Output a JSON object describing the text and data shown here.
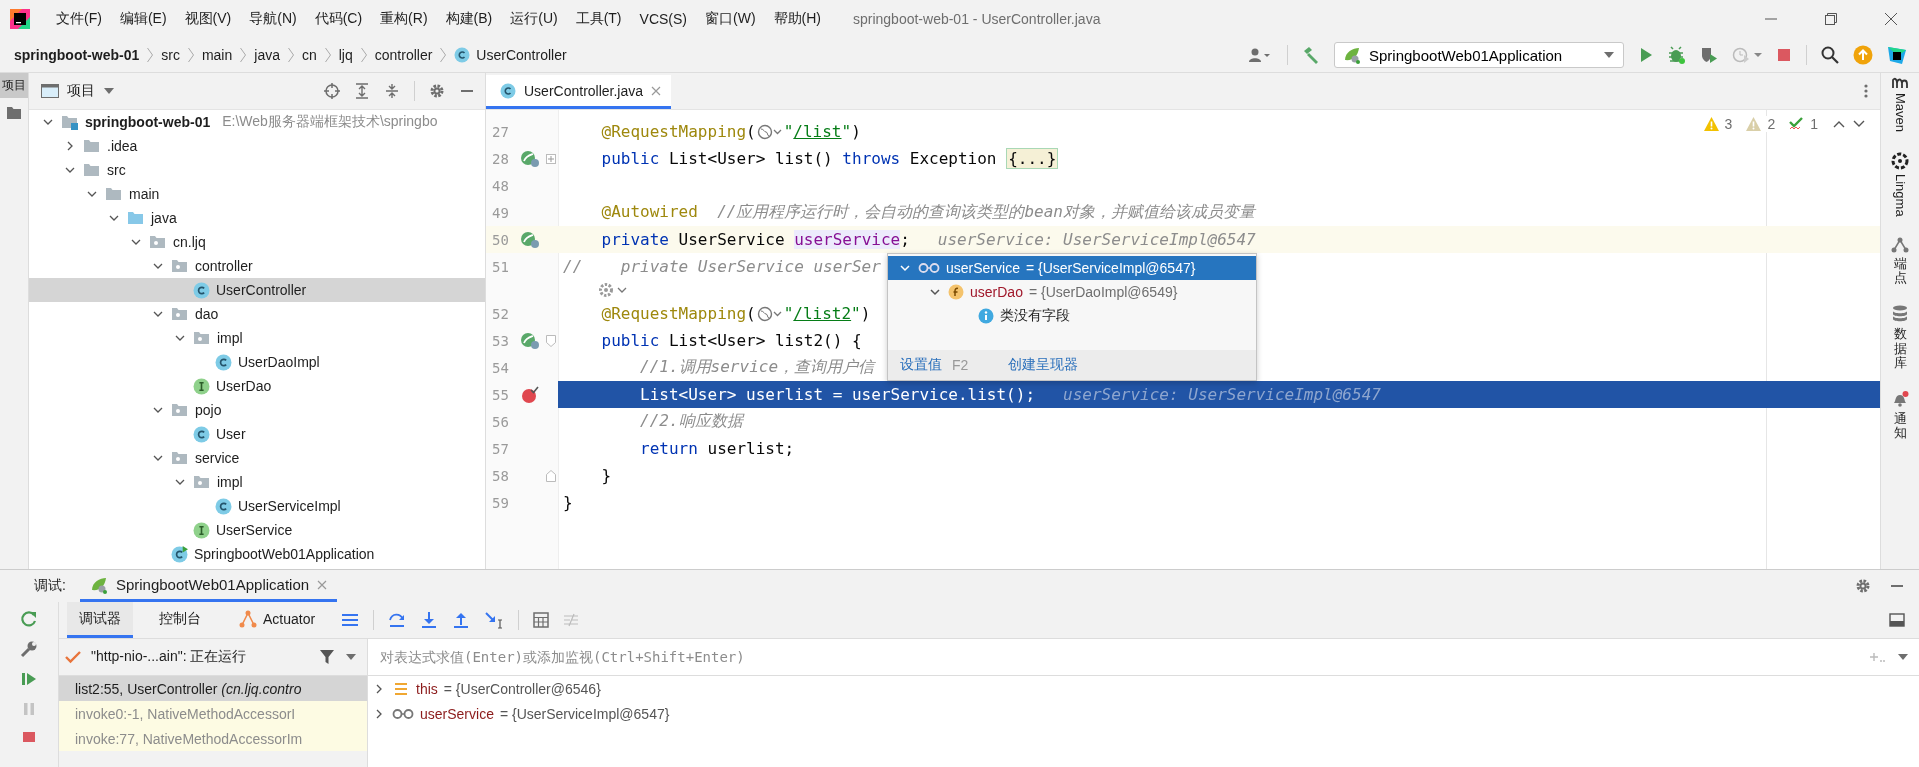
{
  "title_bar": {
    "menu": [
      "文件(F)",
      "编辑(E)",
      "视图(V)",
      "导航(N)",
      "代码(C)",
      "重构(R)",
      "构建(B)",
      "运行(U)",
      "工具(T)",
      "VCS(S)",
      "窗口(W)",
      "帮助(H)"
    ],
    "title": "springboot-web-01 - UserController.java"
  },
  "breadcrumbs": [
    {
      "label": "springboot-web-01",
      "kind": "project"
    },
    {
      "label": "src",
      "kind": "dir"
    },
    {
      "label": "main",
      "kind": "dir"
    },
    {
      "label": "java",
      "kind": "dir"
    },
    {
      "label": "cn",
      "kind": "dir"
    },
    {
      "label": "ljq",
      "kind": "dir"
    },
    {
      "label": "controller",
      "kind": "dir"
    },
    {
      "label": "UserController",
      "kind": "class"
    }
  ],
  "toolbar": {
    "run_config": "SpringbootWeb01Application"
  },
  "left_stripe": [
    {
      "label": "项目",
      "selected": true
    }
  ],
  "project_panel": {
    "title": "项目",
    "tree": [
      {
        "name": "springboot-web-01",
        "kind": "module",
        "detail": "E:\\Web服务器端框架技术\\springbo",
        "expanded": true,
        "selected": false,
        "children": [
          {
            "name": ".idea",
            "kind": "folder",
            "expanded": false,
            "selected": false
          },
          {
            "name": "src",
            "kind": "folder",
            "expanded": true,
            "selected": false,
            "children": [
              {
                "name": "main",
                "kind": "folder",
                "expanded": true,
                "selected": false,
                "children": [
                  {
                    "name": "java",
                    "kind": "source",
                    "expanded": true,
                    "selected": false,
                    "children": [
                      {
                        "name": "cn.ljq",
                        "kind": "package",
                        "expanded": true,
                        "selected": false,
                        "children": [
                          {
                            "name": "controller",
                            "kind": "package",
                            "expanded": true,
                            "selected": false,
                            "children": [
                              {
                                "name": "UserController",
                                "kind": "class",
                                "selected": true
                              }
                            ]
                          },
                          {
                            "name": "dao",
                            "kind": "package",
                            "expanded": true,
                            "selected": false,
                            "children": [
                              {
                                "name": "impl",
                                "kind": "package",
                                "expanded": true,
                                "selected": false,
                                "children": [
                                  {
                                    "name": "UserDaoImpl",
                                    "kind": "class",
                                    "selected": false
                                  }
                                ]
                              },
                              {
                                "name": "UserDao",
                                "kind": "interface",
                                "selected": false
                              }
                            ]
                          },
                          {
                            "name": "pojo",
                            "kind": "package",
                            "expanded": true,
                            "selected": false,
                            "children": [
                              {
                                "name": "User",
                                "kind": "class",
                                "selected": false
                              }
                            ]
                          },
                          {
                            "name": "service",
                            "kind": "package",
                            "expanded": true,
                            "selected": false,
                            "children": [
                              {
                                "name": "impl",
                                "kind": "package",
                                "expanded": true,
                                "selected": false,
                                "children": [
                                  {
                                    "name": "UserServiceImpl",
                                    "kind": "class",
                                    "selected": false
                                  }
                                ]
                              },
                              {
                                "name": "UserService",
                                "kind": "interface",
                                "selected": false
                              }
                            ]
                          },
                          {
                            "name": "SpringbootWeb01Application",
                            "kind": "app",
                            "selected": false
                          }
                        ]
                      }
                    ]
                  }
                ]
              }
            ]
          }
        ]
      }
    ]
  },
  "editor": {
    "tabs": [
      {
        "label": "UserController.java",
        "selected": true
      }
    ],
    "inspections": [
      {
        "kind": "warning",
        "count": "3"
      },
      {
        "kind": "weak-warning",
        "count": "2"
      },
      {
        "kind": "typo",
        "count": "1"
      }
    ],
    "lines": [
      {
        "kind": "code",
        "number": "27",
        "current": false,
        "execution_point": false,
        "tokens": [
          {
            "kind": "annotation",
            "t": "    @RequestMapping"
          },
          {
            "kind": "plain",
            "t": "("
          },
          {
            "kind": "globe"
          },
          {
            "kind": "string",
            "t": "\""
          },
          {
            "kind": "url",
            "t": "/list"
          },
          {
            "kind": "string",
            "t": "\""
          },
          {
            "kind": "plain",
            "t": ")"
          }
        ]
      },
      {
        "kind": "code",
        "number": "28",
        "current": false,
        "execution_point": false,
        "gutter": {
          "kind": "bean"
        },
        "fold": {
          "kind": "folded"
        },
        "tokens": [
          {
            "kind": "keyword",
            "t": "    public"
          },
          {
            "kind": "plain",
            "t": " List<User> list() "
          },
          {
            "kind": "keyword",
            "t": "throws"
          },
          {
            "kind": "plain",
            "t": " Exception "
          },
          {
            "kind": "fold",
            "t": "{...}"
          }
        ]
      },
      {
        "kind": "code",
        "number": "48",
        "current": false,
        "execution_point": false
      },
      {
        "kind": "code",
        "number": "49",
        "current": false,
        "execution_point": false,
        "tokens": [
          {
            "kind": "annotation",
            "t": "    @Autowired"
          },
          {
            "kind": "comment",
            "t": "  //应用程序运行时，会自动的查询该类型的bean对象，并赋值给该成员变量"
          }
        ]
      },
      {
        "kind": "code",
        "number": "50",
        "current": true,
        "execution_point": false,
        "gutter": {
          "kind": "bean"
        },
        "tokens": [
          {
            "kind": "keyword",
            "t": "    private"
          },
          {
            "kind": "plain",
            "t": " UserService "
          },
          {
            "kind": "field",
            "t": "userService"
          },
          {
            "kind": "plain",
            "t": ";"
          },
          {
            "kind": "hint",
            "t": "userService: UserServiceImpl@6547"
          }
        ]
      },
      {
        "kind": "code",
        "number": "51",
        "current": false,
        "execution_point": false,
        "tokens": [
          {
            "kind": "comment",
            "t": "//    private UserService userSer"
          }
        ]
      },
      {
        "kind": "inlay"
      },
      {
        "kind": "code",
        "number": "52",
        "current": false,
        "execution_point": false,
        "tokens": [
          {
            "kind": "annotation",
            "t": "    @RequestMapping"
          },
          {
            "kind": "plain",
            "t": "("
          },
          {
            "kind": "globe"
          },
          {
            "kind": "string",
            "t": "\""
          },
          {
            "kind": "url",
            "t": "/list2"
          },
          {
            "kind": "string",
            "t": "\""
          },
          {
            "kind": "plain",
            "t": ")"
          }
        ]
      },
      {
        "kind": "code",
        "number": "53",
        "current": false,
        "execution_point": false,
        "gutter": {
          "kind": "bean"
        },
        "fold": {
          "kind": "start"
        },
        "tokens": [
          {
            "kind": "keyword",
            "t": "    public"
          },
          {
            "kind": "plain",
            "t": " List<User> list2() {"
          }
        ]
      },
      {
        "kind": "code",
        "number": "54",
        "current": false,
        "execution_point": false,
        "tokens": [
          {
            "kind": "comment",
            "t": "        //1.调用service，查询用户信"
          }
        ]
      },
      {
        "kind": "code",
        "number": "55",
        "current": false,
        "execution_point": true,
        "gutter": {
          "kind": "breakpoint"
        },
        "tokens": [
          {
            "kind": "plain",
            "t": "        List<User> userlist = userService.list();"
          },
          {
            "kind": "hint",
            "t": "userService: UserServiceImpl@6547"
          }
        ]
      },
      {
        "kind": "code",
        "number": "56",
        "current": false,
        "execution_point": false,
        "tokens": [
          {
            "kind": "comment",
            "t": "        //2.响应数据"
          }
        ]
      },
      {
        "kind": "code",
        "number": "57",
        "current": false,
        "execution_point": false,
        "tokens": [
          {
            "kind": "keyword",
            "t": "        return"
          },
          {
            "kind": "plain",
            "t": " userlist;"
          }
        ]
      },
      {
        "kind": "code",
        "number": "58",
        "current": false,
        "execution_point": false,
        "fold": {
          "kind": "end"
        },
        "tokens": [
          {
            "kind": "plain",
            "t": "    }"
          }
        ]
      },
      {
        "kind": "code",
        "number": "59",
        "current": false,
        "execution_point": false,
        "tokens": [
          {
            "kind": "plain",
            "t": "}"
          }
        ]
      }
    ],
    "popup": {
      "tree": [
        {
          "kind": "watch",
          "name": "userService",
          "value": "= {UserServiceImpl@6547}",
          "expanded": true,
          "selected": true,
          "children": [
            {
              "kind": "field",
              "name": "userDao",
              "value": "= {UserDaoImpl@6549}",
              "expanded": true,
              "selected": false,
              "children": [
                {
                  "kind": "info",
                  "name": "类没有字段",
                  "selected": false
                }
              ]
            }
          ]
        }
      ],
      "actions": [
        {
          "label": "设置值",
          "shortcut": "F2"
        },
        {
          "label": "创建呈现器"
        }
      ]
    }
  },
  "right_stripe": [
    {
      "label": "Maven",
      "kind": "maven"
    },
    {
      "label": "Lingma",
      "kind": "lingma"
    },
    {
      "label": "端点",
      "kind": "endpoints"
    },
    {
      "label": "数据库",
      "kind": "database"
    },
    {
      "label": "通知",
      "kind": "notifications"
    }
  ],
  "debug": {
    "label": "调试:",
    "session": "SpringbootWeb01Application",
    "tabs": [
      {
        "label": "调试器",
        "kind": "debugger",
        "selected": true
      },
      {
        "label": "控制台",
        "kind": "console",
        "selected": false
      },
      {
        "label": "Actuator",
        "kind": "actuator",
        "selected": false
      }
    ],
    "thread": "\"http-nio-...ain\": 正在运行",
    "frames": [
      {
        "text": "list2:55, UserController *(cn.ljq.contro*",
        "kind": "user",
        "selected": true
      },
      {
        "text": "invoke0:-1, NativeMethodAccessorI",
        "kind": "library",
        "selected": false
      },
      {
        "text": "invoke:77, NativeMethodAccessorIm",
        "kind": "library",
        "selected": false
      }
    ],
    "eval_placeholder": "对表达式求值(Enter)或添加监视(Ctrl+Shift+Enter)",
    "variables": [
      {
        "kind": "this",
        "name": "this",
        "value": "= {UserController@6546}",
        "expanded": false
      },
      {
        "kind": "watch",
        "name": "userService",
        "value": "= {UserServiceImpl@6547}",
        "expanded": false
      }
    ]
  }
}
